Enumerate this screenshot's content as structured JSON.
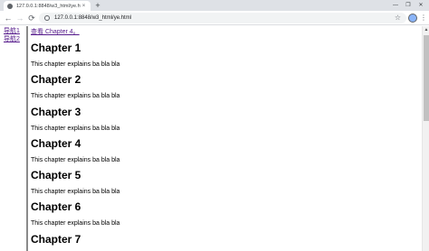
{
  "browser": {
    "tab": {
      "title": "127.0.0.1:8848/w3_html/ye.html",
      "close_glyph": "×"
    },
    "new_tab_glyph": "+",
    "window_controls": {
      "minimize": "—",
      "restore": "❐",
      "close": "✕"
    },
    "nav": {
      "back": "←",
      "forward": "→",
      "reload": "⟳"
    },
    "address_bar": {
      "url": "127.0.0.1:8848/w3_html/ye.html"
    },
    "star_glyph": "☆",
    "menu_glyph": "⋮"
  },
  "page": {
    "side_nav": [
      {
        "label": "导航1"
      },
      {
        "label": "导航2"
      }
    ],
    "top_link": "查看 Chapter 4。",
    "chapters": [
      {
        "heading": "Chapter 1",
        "text": "This chapter explains ba bla bla"
      },
      {
        "heading": "Chapter 2",
        "text": "This chapter explains ba bla bla"
      },
      {
        "heading": "Chapter 3",
        "text": "This chapter explains ba bla bla"
      },
      {
        "heading": "Chapter 4",
        "text": "This chapter explains ba bla bla"
      },
      {
        "heading": "Chapter 5",
        "text": "This chapter explains ba bla bla"
      },
      {
        "heading": "Chapter 6",
        "text": "This chapter explains ba bla bla"
      },
      {
        "heading": "Chapter 7",
        "text": ""
      }
    ]
  },
  "colors": {
    "visited_link": "#551a8b",
    "tabstrip": "#dee1e6",
    "omnibox": "#f1f3f4"
  }
}
